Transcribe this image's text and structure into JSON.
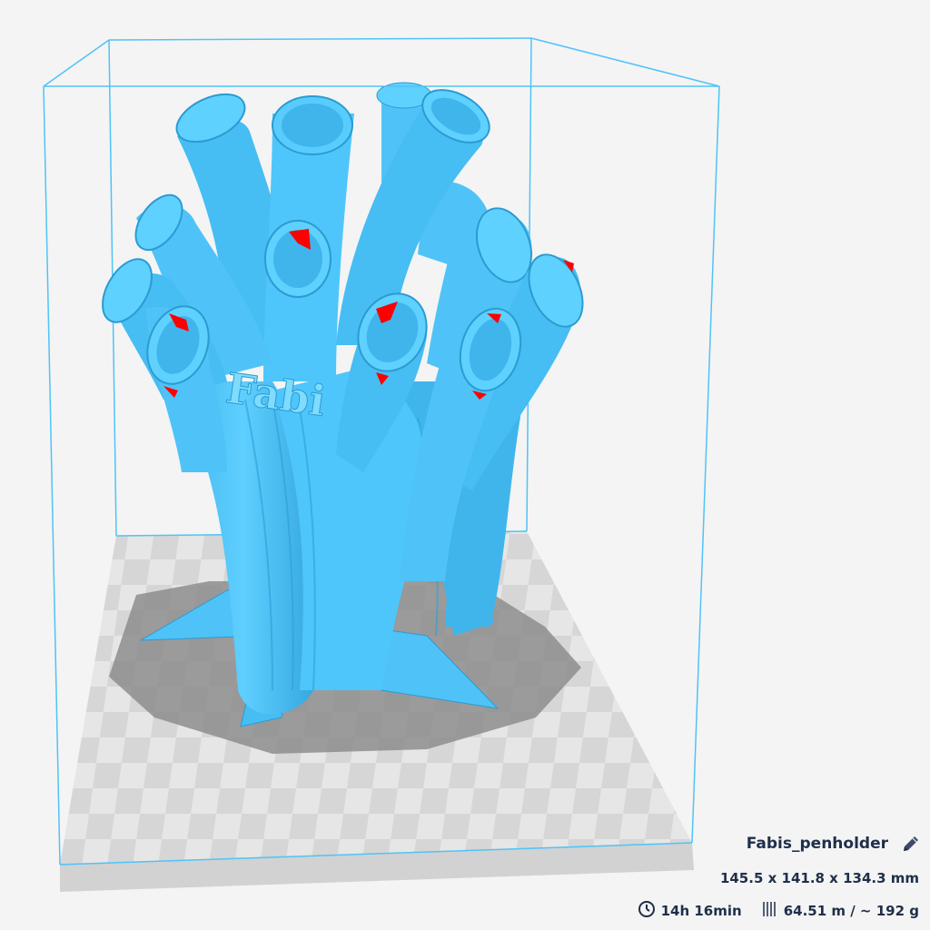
{
  "model": {
    "name": "Fabis_penholder",
    "dimensions": "145.5 x 141.8 x 134.3 mm",
    "engraving": "Fabi"
  },
  "estimate": {
    "time": "14h 16min",
    "material": "64.51 m / ~ 192 g"
  },
  "icons": {
    "edit": "pencil-icon",
    "time": "clock-icon",
    "material": "filament-spool-icon"
  },
  "colors": {
    "background": "#f4f4f4",
    "model": "#4fc3f7",
    "model_shade": "#1f9fd8",
    "overhang": "#ff0000",
    "build_volume_outline": "#4fc3f7",
    "info_text": "#1e2f4a"
  }
}
